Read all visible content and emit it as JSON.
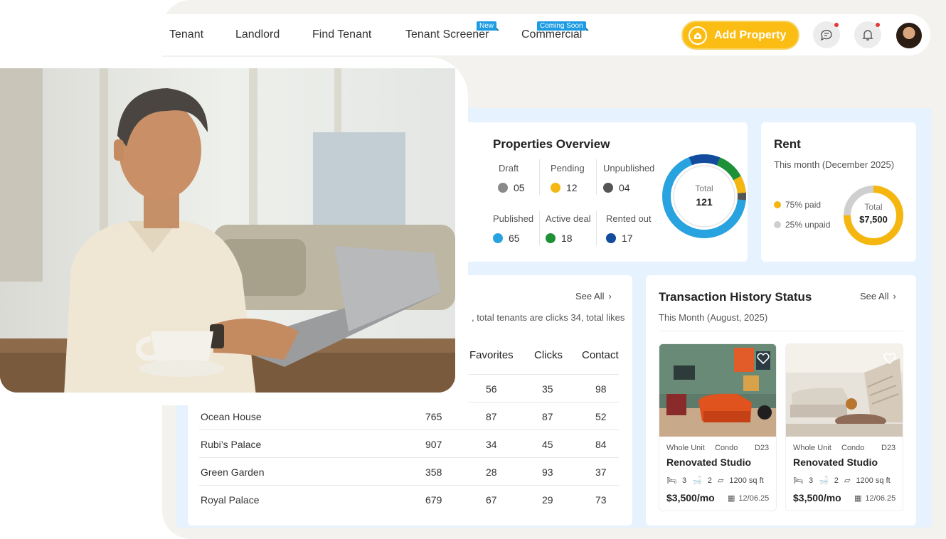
{
  "nav": {
    "links": [
      "Tenant",
      "Landlord",
      "Find Tenant",
      "Tenant Screener",
      "Commercial"
    ],
    "badges": {
      "tenant_screener": "New",
      "commercial": "Coming Soon"
    },
    "add_property": "Add Property"
  },
  "overview": {
    "title": "Properties Overview",
    "stats": [
      {
        "label": "Draft",
        "value": "05",
        "color": "#8a8a8a"
      },
      {
        "label": "Pending",
        "value": "12",
        "color": "#f5b70f"
      },
      {
        "label": "Unpublished",
        "value": "04",
        "color": "#555555"
      },
      {
        "label": "Published",
        "value": "65",
        "color": "#29a3e0"
      },
      {
        "label": "Active deal",
        "value": "18",
        "color": "#1e9137"
      },
      {
        "label": "Rented out",
        "value": "17",
        "color": "#134c9c"
      }
    ],
    "total_label": "Total",
    "total_value": "121"
  },
  "rent": {
    "title": "Rent",
    "subtitle": "This month (December 2025)",
    "paid": "75% paid",
    "unpaid": "25% unpaid",
    "paid_fraction": 0.75,
    "total_label": "Total",
    "total_value": "$7,500",
    "colors": {
      "paid": "#f5b70f",
      "unpaid": "#cfcfcf"
    }
  },
  "performance": {
    "see_all": "See All",
    "summary": ", total tenants are clicks 34, total likes",
    "headers": [
      "Favorites",
      "Clicks",
      "Contact"
    ],
    "first_row": {
      "favorites": "56",
      "clicks": "35",
      "contact": "98"
    },
    "rows": [
      {
        "name": "Ocean House",
        "views": "765",
        "favorites": "87",
        "clicks": "87",
        "contact": "52"
      },
      {
        "name": "Rubi’s Palace",
        "views": "907",
        "favorites": "34",
        "clicks": "45",
        "contact": "84"
      },
      {
        "name": "Green Garden",
        "views": "358",
        "favorites": "28",
        "clicks": "93",
        "contact": "37"
      },
      {
        "name": "Royal Palace",
        "views": "679",
        "favorites": "67",
        "clicks": "29",
        "contact": "73"
      }
    ]
  },
  "transactions": {
    "title": "Transaction History Status",
    "see_all": "See All",
    "subtitle": "This Month (August, 2025)",
    "cards": [
      {
        "type": "Whole Unit",
        "kind": "Condo",
        "district": "D23",
        "name": "Renovated Studio",
        "beds": "3",
        "baths": "2",
        "area": "1200 sq ft",
        "price": "$3,500/mo",
        "date": "12/06.25"
      },
      {
        "type": "Whole Unit",
        "kind": "Condo",
        "district": "D23",
        "name": "Renovated Studio",
        "beds": "3",
        "baths": "2",
        "area": "1200 sq ft",
        "price": "$3,500/mo",
        "date": "12/06.25"
      }
    ]
  }
}
